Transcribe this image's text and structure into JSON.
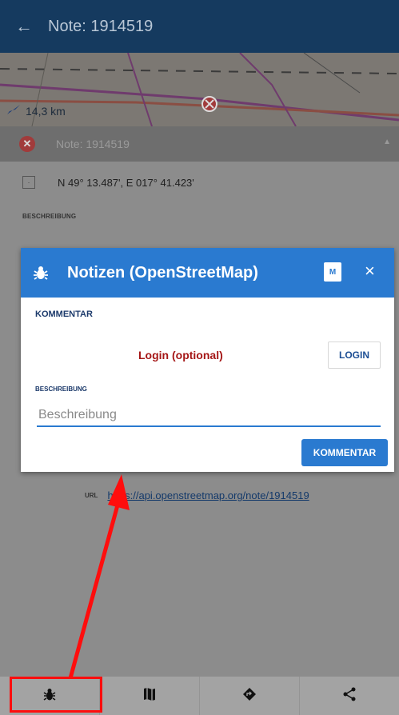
{
  "appbar": {
    "back_icon": "arrow-left-icon",
    "title": "Note: 1914519"
  },
  "map": {
    "distance": "14,3 km"
  },
  "subheader": {
    "title": "Note: 1914519"
  },
  "details": {
    "coordinates": "N 49° 13.487', E 017° 41.423'",
    "description_label": "BESCHREIBUNG",
    "url_label": "URL",
    "url_value": "https://api.openstreetmap.org/note/1914519"
  },
  "dialog": {
    "title": "Notizen (OpenStreetMap)",
    "badge": "M",
    "close": "×",
    "comment_section_label": "KOMMENTAR",
    "login_text": "Login (optional)",
    "login_button": "LOGIN",
    "description_label": "BESCHREIBUNG",
    "description_placeholder": "Beschreibung",
    "comment_button": "KOMMENTAR"
  },
  "bottom_tabs": [
    {
      "icon": "bug-icon"
    },
    {
      "icon": "map-icon"
    },
    {
      "icon": "navigate-icon"
    },
    {
      "icon": "share-icon"
    }
  ],
  "colors": {
    "appbar": "#153a5f",
    "dialog_header": "#2a7ad0",
    "highlight": "#ff0d0d"
  }
}
